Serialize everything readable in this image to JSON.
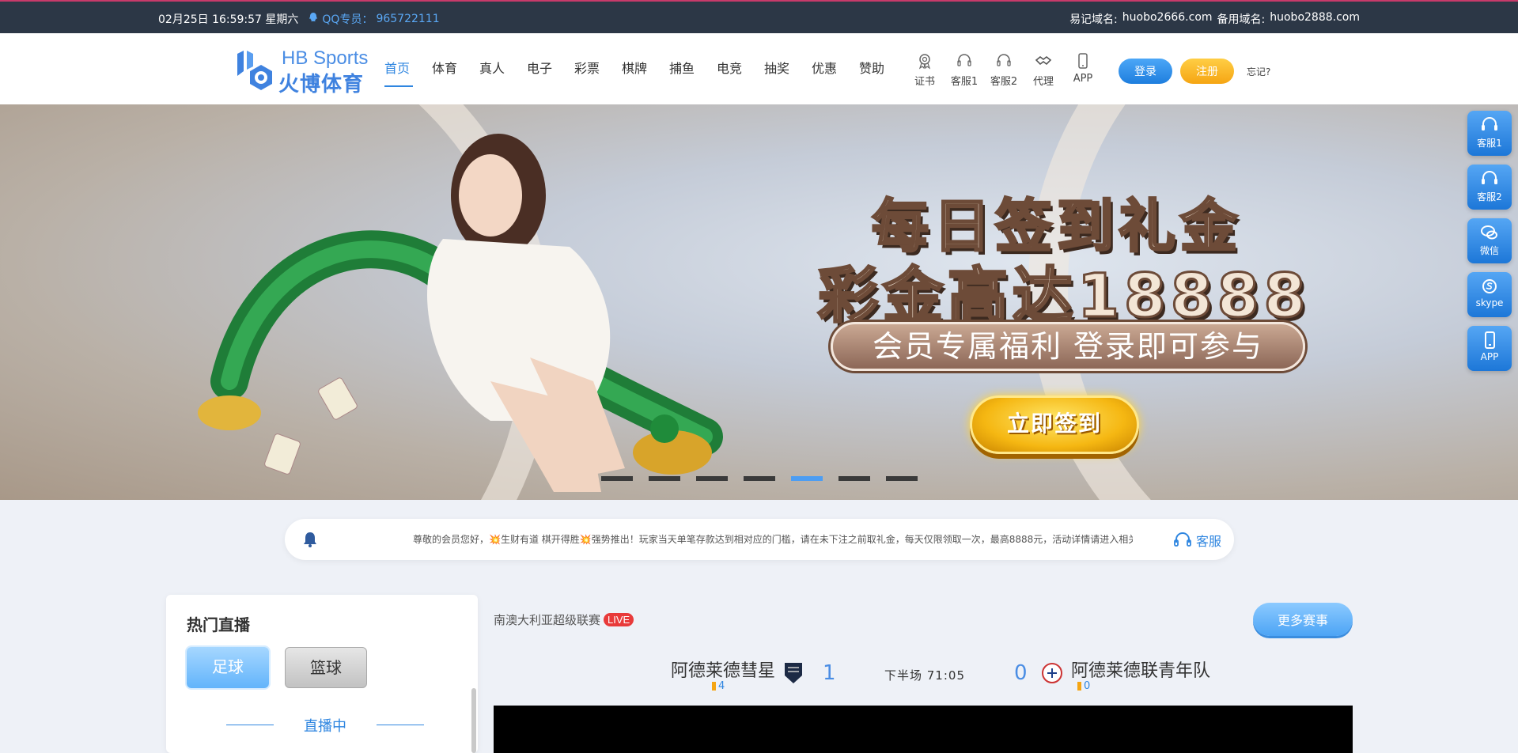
{
  "topbar": {
    "datetime": "02月25日 16:59:57 星期六",
    "qq_label": "QQ专员：",
    "qq_number": "965722111",
    "domain_label": "易记域名:",
    "domain": "huobo2666.com",
    "backup_label": "备用域名:",
    "backup_domain": "huobo2888.com"
  },
  "logo": {
    "en": "HB Sports",
    "cn": "火博体育"
  },
  "nav": [
    "首页",
    "体育",
    "真人",
    "电子",
    "彩票",
    "棋牌",
    "捕鱼",
    "电竞",
    "抽奖",
    "优惠",
    "赞助"
  ],
  "tools": [
    {
      "label": "证书",
      "icon": "certificate-icon"
    },
    {
      "label": "客服1",
      "icon": "headset-icon"
    },
    {
      "label": "客服2",
      "icon": "headset-icon"
    },
    {
      "label": "代理",
      "icon": "handshake-icon"
    },
    {
      "label": "APP",
      "icon": "phone-icon"
    }
  ],
  "auth": {
    "login": "登录",
    "register": "注册",
    "forgot": "忘记?"
  },
  "banner": {
    "line1": "每日签到礼金",
    "line2": "彩金高达18888",
    "pill": "会员专属福利 登录即可参与",
    "button": "立即签到",
    "slide_count": 7,
    "active_slide": 5
  },
  "side": [
    {
      "label": "客服1",
      "icon": "headset-icon"
    },
    {
      "label": "客服2",
      "icon": "headset-icon"
    },
    {
      "label": "微信",
      "icon": "wechat-icon"
    },
    {
      "label": "skype",
      "icon": "skype-icon"
    },
    {
      "label": "APP",
      "icon": "phone-icon"
    }
  ],
  "notice": {
    "text": "尊敬的会员您好，💥生财有道 棋开得胜💥强势推出！玩家当天单笔存款达到相对应的门槛，请在未下注之前取礼金，每天仅限领取一次，最高8888元，活动详情请进入相关优惠页面查看",
    "cs": "客服"
  },
  "hot": {
    "title": "热门直播",
    "tab_soccer": "足球",
    "tab_basketball": "篮球",
    "live_label": "直播中"
  },
  "match": {
    "league": "南澳大利亚超级联赛",
    "live_badge": "LIVE",
    "more": "更多赛事",
    "home_team": "阿德莱德彗星",
    "home_count": "4",
    "home_score": "1",
    "period": "下半场 71:05",
    "away_score": "0",
    "away_team": "阿德莱德联青年队",
    "away_count": "0"
  },
  "colors": {
    "accent": "#2f86e0",
    "topbar": "#2c3746",
    "register": "#f5a513",
    "live": "#e83a3a"
  }
}
